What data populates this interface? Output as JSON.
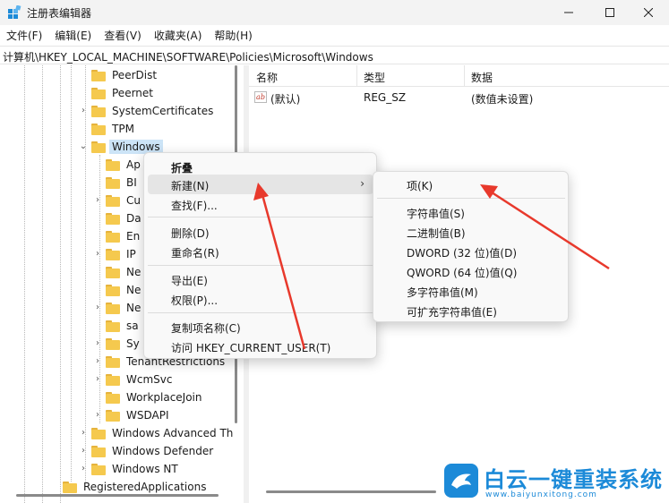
{
  "window": {
    "title": "注册表编辑器",
    "minimize": "—",
    "maximize": "☐",
    "close": "✕"
  },
  "menubar": {
    "items": [
      "文件(F)",
      "编辑(E)",
      "查看(V)",
      "收藏夹(A)",
      "帮助(H)"
    ]
  },
  "address": {
    "path": "计算机\\HKEY_LOCAL_MACHINE\\SOFTWARE\\Policies\\Microsoft\\Windows"
  },
  "tree": {
    "nodes": [
      "PeerDist",
      "Peernet",
      "SystemCertificates",
      "TPM",
      "Windows",
      "Ap",
      "BI",
      "Cu",
      "Da",
      "En",
      "IP",
      "Ne",
      "Ne",
      "Ne",
      "sa",
      "Sy",
      "TenantRestrictions",
      "WcmSvc",
      "WorkplaceJoin",
      "WSDAPI",
      "Windows Advanced Th",
      "Windows Defender",
      "Windows NT",
      "RegisteredApplications"
    ]
  },
  "list": {
    "columns": [
      "名称",
      "类型",
      "数据"
    ],
    "rows": [
      {
        "name": "(默认)",
        "type": "REG_SZ",
        "data": "(数值未设置)"
      }
    ]
  },
  "context_menu": {
    "collapse": "折叠",
    "new": "新建(N)",
    "find": "查找(F)...",
    "delete": "删除(D)",
    "rename": "重命名(R)",
    "export": "导出(E)",
    "permissions": "权限(P)...",
    "copy_key_name": "复制项名称(C)",
    "goto_hkcu": "访问 HKEY_CURRENT_USER(T)"
  },
  "submenu": {
    "key": "项(K)",
    "string_value": "字符串值(S)",
    "binary_value": "二进制值(B)",
    "dword_value": "DWORD (32 位)值(D)",
    "qword_value": "QWORD (64 位)值(Q)",
    "multi_string_value": "多字符串值(M)",
    "expandable_string_value": "可扩充字符串值(E)"
  },
  "watermark": {
    "title": "白云一键重装系统",
    "url": "www.baiyunxitong.com"
  },
  "colors": {
    "accent": "#1c8ad8",
    "selection": "#cce4f7",
    "annotation_arrow": "#e8392c",
    "folder": "#f5c94e"
  }
}
